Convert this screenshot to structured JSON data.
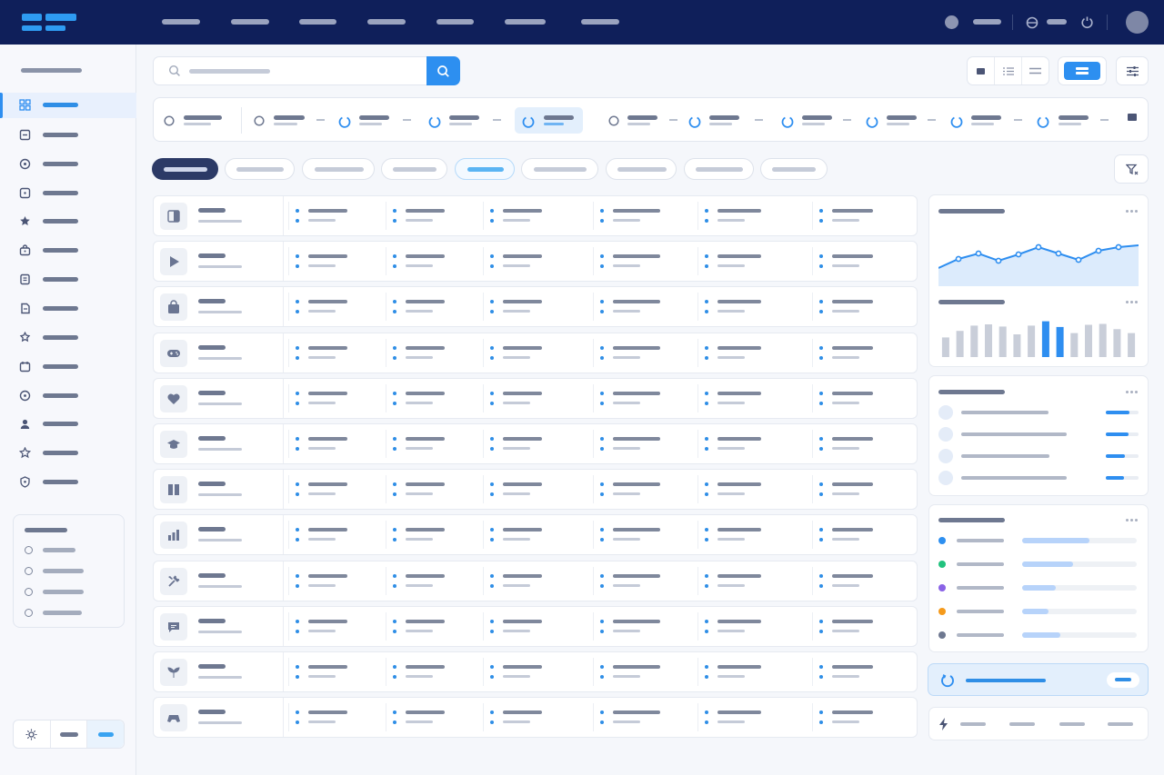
{
  "app": {
    "title": ""
  },
  "colors": {
    "navy": "#0f1f5a",
    "accent": "#2d8ff0",
    "pale": "#e3effc",
    "green": "#22c27e",
    "purple": "#8a63e6",
    "orange": "#f59a1b",
    "slate": "#6e7890"
  },
  "topbar": {
    "logo_icon": "logo-icon",
    "nav_links": [
      "",
      "",
      "",
      "",
      "",
      "",
      ""
    ],
    "right_icons": [
      "status-dot-icon",
      "globe-icon",
      "power-icon",
      "avatar"
    ]
  },
  "sidebar": {
    "header": "",
    "items": [
      {
        "icon": "grid-icon",
        "label": "",
        "active": true
      },
      {
        "icon": "card-icon",
        "label": ""
      },
      {
        "icon": "clock-icon",
        "label": ""
      },
      {
        "icon": "tag-icon",
        "label": ""
      },
      {
        "icon": "star-filled-icon",
        "label": ""
      },
      {
        "icon": "bag-icon",
        "label": ""
      },
      {
        "icon": "document-icon",
        "label": ""
      },
      {
        "icon": "copy-icon",
        "label": ""
      },
      {
        "icon": "puzzle-icon",
        "label": ""
      },
      {
        "icon": "calendar-icon",
        "label": ""
      },
      {
        "icon": "target-icon",
        "label": ""
      },
      {
        "icon": "user-icon",
        "label": ""
      },
      {
        "icon": "star-icon",
        "label": ""
      },
      {
        "icon": "shield-icon",
        "label": ""
      }
    ],
    "panel": {
      "title": "",
      "options": [
        "",
        "",
        "",
        ""
      ]
    },
    "theme_switch": [
      "sun-icon",
      "",
      ""
    ]
  },
  "toolbar": {
    "search_placeholder": "",
    "search_icon": "search-icon",
    "view_modes": [
      "grid-view-icon",
      "list-view-icon",
      "compact-view-icon"
    ],
    "primary_button_label": "",
    "settings_icon": "sliders-icon"
  },
  "stepper": {
    "steps": [
      {
        "label": "",
        "state": "idle"
      },
      {
        "label": "",
        "state": "idle"
      },
      {
        "label": "",
        "state": "running"
      },
      {
        "label": "",
        "state": "running"
      },
      {
        "label": "",
        "state": "active"
      },
      {
        "label": "",
        "state": "idle"
      },
      {
        "label": "",
        "state": "running"
      },
      {
        "label": "",
        "state": "running"
      },
      {
        "label": "",
        "state": "running"
      },
      {
        "label": "",
        "state": "running"
      },
      {
        "label": "",
        "state": "running"
      }
    ]
  },
  "filters": {
    "chips": [
      {
        "label": "",
        "state": "active"
      },
      {
        "label": ""
      },
      {
        "label": ""
      },
      {
        "label": ""
      },
      {
        "label": "",
        "state": "selected"
      },
      {
        "label": ""
      },
      {
        "label": ""
      },
      {
        "label": ""
      },
      {
        "label": ""
      }
    ],
    "filter_icon": "filter-icon"
  },
  "table": {
    "rows": [
      {
        "icon": "panel-icon",
        "name": "",
        "sub": "",
        "cells": [
          "",
          "",
          "",
          "",
          "",
          "",
          ""
        ]
      },
      {
        "icon": "play-icon",
        "name": "",
        "sub": "",
        "cells": [
          "",
          "",
          "",
          "",
          "",
          "",
          ""
        ]
      },
      {
        "icon": "bag-icon",
        "name": "",
        "sub": "",
        "cells": [
          "",
          "",
          "",
          "",
          "",
          "",
          ""
        ]
      },
      {
        "icon": "gamepad-icon",
        "name": "",
        "sub": "",
        "cells": [
          "",
          "",
          "",
          "",
          "",
          "",
          ""
        ]
      },
      {
        "icon": "heart-icon",
        "name": "",
        "sub": "",
        "cells": [
          "",
          "",
          "",
          "",
          "",
          "",
          ""
        ]
      },
      {
        "icon": "graduation-cap-icon",
        "name": "",
        "sub": "",
        "cells": [
          "",
          "",
          "",
          "",
          "",
          "",
          ""
        ]
      },
      {
        "icon": "book-icon",
        "name": "",
        "sub": "",
        "cells": [
          "",
          "",
          "",
          "",
          "",
          "",
          ""
        ]
      },
      {
        "icon": "bar-chart-icon",
        "name": "",
        "sub": "",
        "cells": [
          "",
          "",
          "",
          "",
          "",
          "",
          ""
        ]
      },
      {
        "icon": "tools-icon",
        "name": "",
        "sub": "",
        "cells": [
          "",
          "",
          "",
          "",
          "",
          "",
          ""
        ]
      },
      {
        "icon": "chat-icon",
        "name": "",
        "sub": "",
        "cells": [
          "",
          "",
          "",
          "",
          "",
          "",
          ""
        ]
      },
      {
        "icon": "plant-icon",
        "name": "",
        "sub": "",
        "cells": [
          "",
          "",
          "",
          "",
          "",
          "",
          ""
        ]
      },
      {
        "icon": "controller-icon",
        "name": "",
        "sub": "",
        "cells": [
          "",
          "",
          "",
          "",
          "",
          "",
          ""
        ]
      }
    ]
  },
  "panels": {
    "trend": {
      "title": ""
    },
    "bars": {
      "title": ""
    },
    "list": {
      "title": "",
      "items": [
        "",
        "",
        "",
        ""
      ]
    },
    "legend": {
      "title": "",
      "items": [
        {
          "color": "#2d8ff0",
          "label": "",
          "value": 0.6
        },
        {
          "color": "#22c27e",
          "label": "",
          "value": 0.45
        },
        {
          "color": "#8a63e6",
          "label": "",
          "value": 0.3
        },
        {
          "color": "#f59a1b",
          "label": "",
          "value": 0.23
        },
        {
          "color": "#6e7890",
          "label": "",
          "value": 0.34
        }
      ]
    },
    "callout": {
      "label": "",
      "button": ""
    },
    "actions": {
      "items": [
        "",
        "",
        "",
        ""
      ]
    }
  },
  "chart_data": [
    {
      "type": "area",
      "x": [
        1,
        2,
        3,
        4,
        5,
        6,
        7,
        8,
        9,
        10
      ],
      "series": [
        {
          "values": [
            2,
            3,
            3.6,
            2.8,
            3.5,
            4.3,
            3.6,
            2.9,
            3.9,
            4.3,
            4.5
          ]
        }
      ],
      "ylim": [
        0,
        6
      ],
      "grid": false
    },
    {
      "type": "bar",
      "values": [
        4.5,
        6,
        7.2,
        7.5,
        7,
        5.2,
        7.2,
        8.2,
        6.9,
        5.5,
        7.4,
        7.6,
        6.4,
        5.5
      ],
      "highlighted": [
        7,
        8
      ],
      "ylim": [
        0,
        10
      ],
      "grid": false
    }
  ]
}
